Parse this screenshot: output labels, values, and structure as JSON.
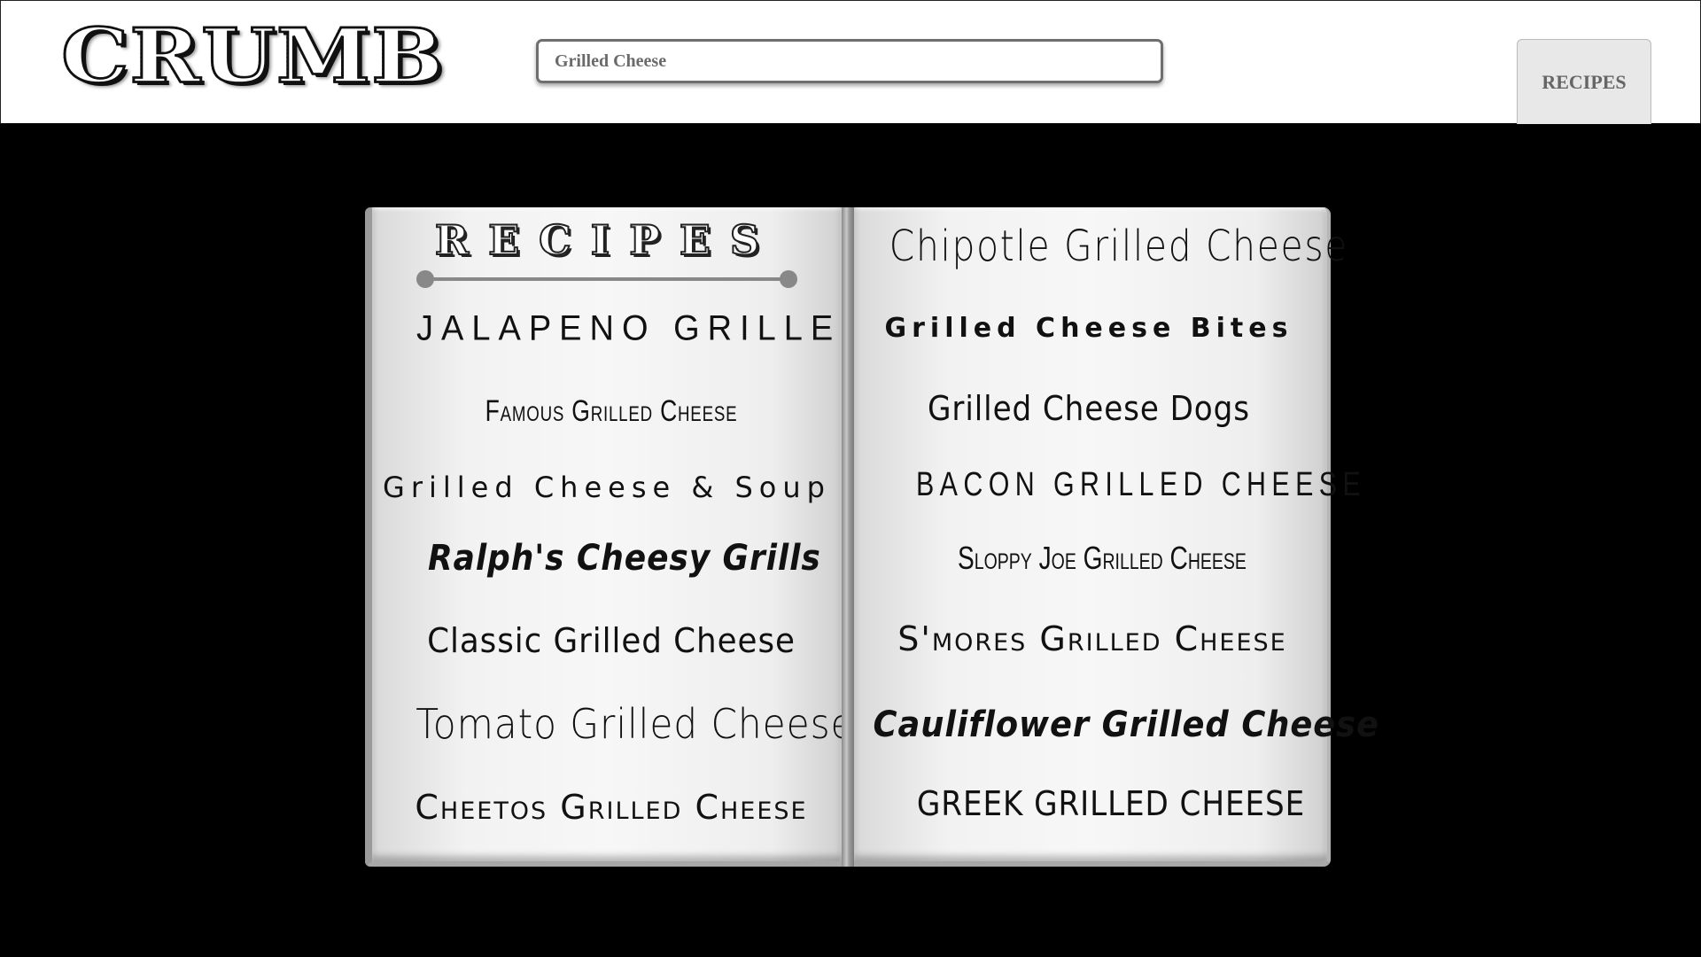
{
  "header": {
    "logo": "CRUMB",
    "search": {
      "value": "Grilled Cheese",
      "placeholder": ""
    },
    "nav_button": "RECIPES"
  },
  "book": {
    "title": "RECIPES",
    "left_page": [
      "JALAPENO GRILLED CHEESE",
      "Famous Grilled Cheese",
      "Grilled Cheese & Soup",
      "Ralph's Cheesy Grills",
      "Classic Grilled Cheese",
      "Tomato Grilled Cheese",
      "Cheetos Grilled Cheese"
    ],
    "right_page": [
      "Chipotle Grilled Cheese",
      "Grilled Cheese Bites",
      "Grilled Cheese Dogs",
      "BACON GRILLED CHEESE",
      "Sloppy Joe Grilled Cheese",
      "S'mores Grilled Cheese",
      "Cauliflower Grilled Cheese",
      "GREEK GRILLED CHEESE"
    ]
  },
  "colors": {
    "background": "#000000",
    "header_bg": "#ffffff",
    "button_bg": "#e8e8e8",
    "page_bg": "#f2f2f2",
    "text": "#111111"
  }
}
